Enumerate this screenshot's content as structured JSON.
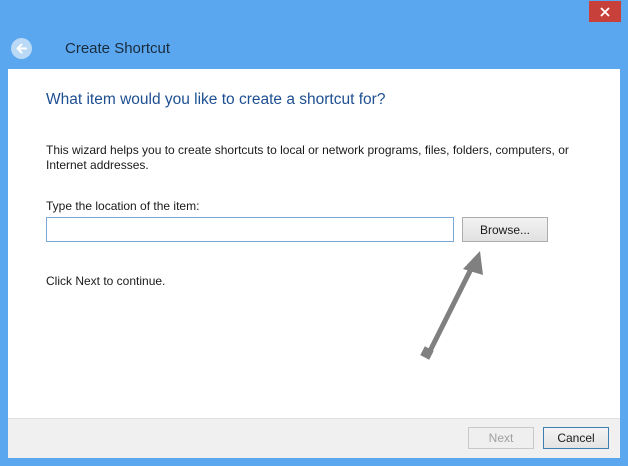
{
  "window": {
    "title": "Create Shortcut",
    "accent_color": "#5aa7f0",
    "close_color": "#c7413a"
  },
  "icons": {
    "back": "back-arrow-icon",
    "close": "close-icon",
    "annotation": "annotation-arrow-icon"
  },
  "page": {
    "heading": "What item would you like to create a shortcut for?",
    "description": "This wizard helps you to create shortcuts to local or network programs, files, folders, computers, or Internet addresses.",
    "location_label": "Type the location of the item:",
    "location_value": "",
    "browse_label": "Browse...",
    "continue_text": "Click Next to continue."
  },
  "footer": {
    "next_label": "Next",
    "cancel_label": "Cancel"
  }
}
